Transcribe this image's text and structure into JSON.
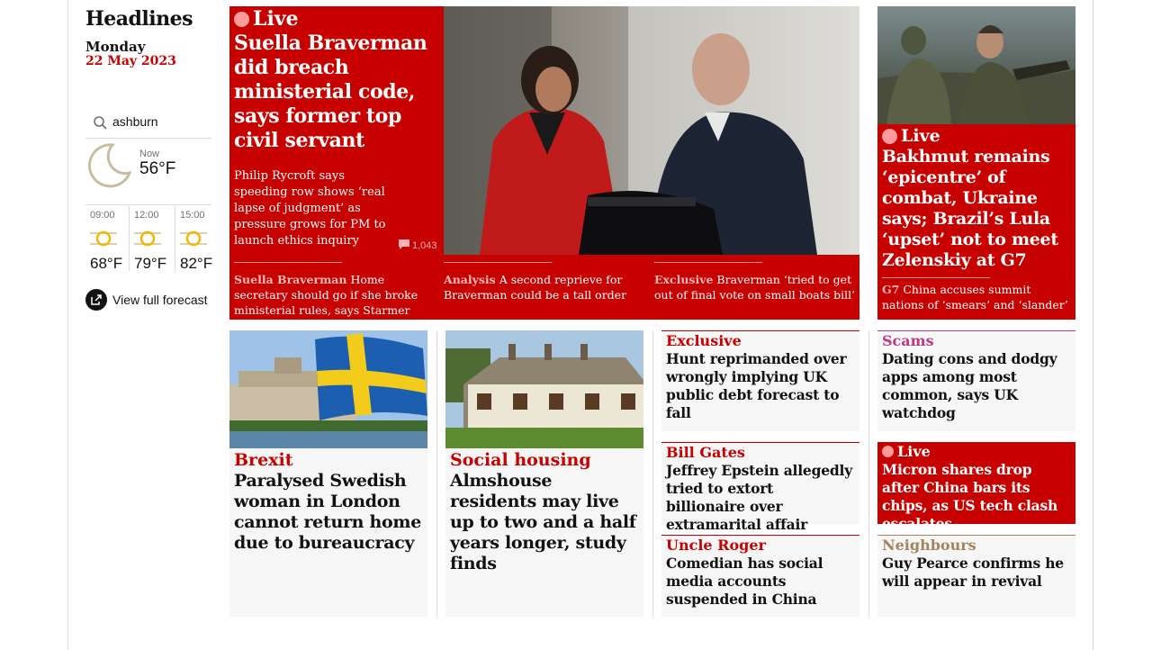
{
  "sidebar": {
    "title": "Headlines",
    "day": "Monday",
    "date": "22 May 2023",
    "location": "ashburn",
    "now_label": "Now",
    "now_temp": "56°F",
    "hourly": [
      {
        "time": "09:00",
        "temp": "68°F"
      },
      {
        "time": "12:00",
        "temp": "79°F"
      },
      {
        "time": "15:00",
        "temp": "82°F"
      }
    ],
    "forecast_link": "View full forecast"
  },
  "hero": {
    "live_label": "Live",
    "headline": "Suella Braverman did breach ministerial code, says former top civil servant",
    "standfirst": "Philip Rycroft says speeding row shows ‘real lapse of judgment’ as pressure grows for PM to launch ethics inquiry",
    "comments": "1,043",
    "sublinks": [
      {
        "kicker": "Suella Braverman",
        "text": "Home secretary should go if she broke ministerial rules, says Starmer"
      },
      {
        "kicker": "Analysis",
        "text": "A second reprieve for Braverman could be a tall order"
      },
      {
        "kicker": "Exclusive",
        "text": "Braverman ‘tried to get out of final vote on small boats bill’"
      }
    ]
  },
  "right_hero": {
    "live_label": "Live",
    "headline": "Bakhmut remains ‘epicentre’ of combat, Ukraine says; Brazil’s Lula ‘upset’ not to meet Zelenskiy at G7",
    "sub_kicker": "G7",
    "sub_text": "China accuses summit nations of ‘smears’ and ‘slander’"
  },
  "cards": {
    "brexit": {
      "kicker": "Brexit",
      "headline": "Paralysed Swedish woman in London cannot return home due to bureaucracy"
    },
    "housing": {
      "kicker": "Social housing",
      "headline": "Almshouse residents may live up to two and a half years longer, study finds"
    },
    "hunt": {
      "kicker": "Exclusive",
      "headline": "Hunt reprimanded over wrongly implying UK public debt forecast to fall"
    },
    "gates": {
      "kicker": "Bill Gates",
      "headline": "Jeffrey Epstein allegedly tried to extort billionaire over extramarital affair"
    },
    "roger": {
      "kicker": "Uncle Roger",
      "headline": "Comedian has social media accounts suspended in China"
    },
    "scams": {
      "kicker": "Scams",
      "headline": "Dating cons and dodgy apps among most common, says UK watchdog"
    },
    "micron": {
      "kicker": "Live",
      "headline": "Micron shares drop after China bars its chips, as US tech clash escalates"
    },
    "neighbours": {
      "kicker": "Neighbours",
      "headline": "Guy Pearce confirms he will appear in revival"
    }
  },
  "colors": {
    "news_red": "#c70000",
    "scams_pink": "#bb3b80",
    "culture_brown": "#a1845c",
    "live_dot": "#ff9b9b"
  }
}
